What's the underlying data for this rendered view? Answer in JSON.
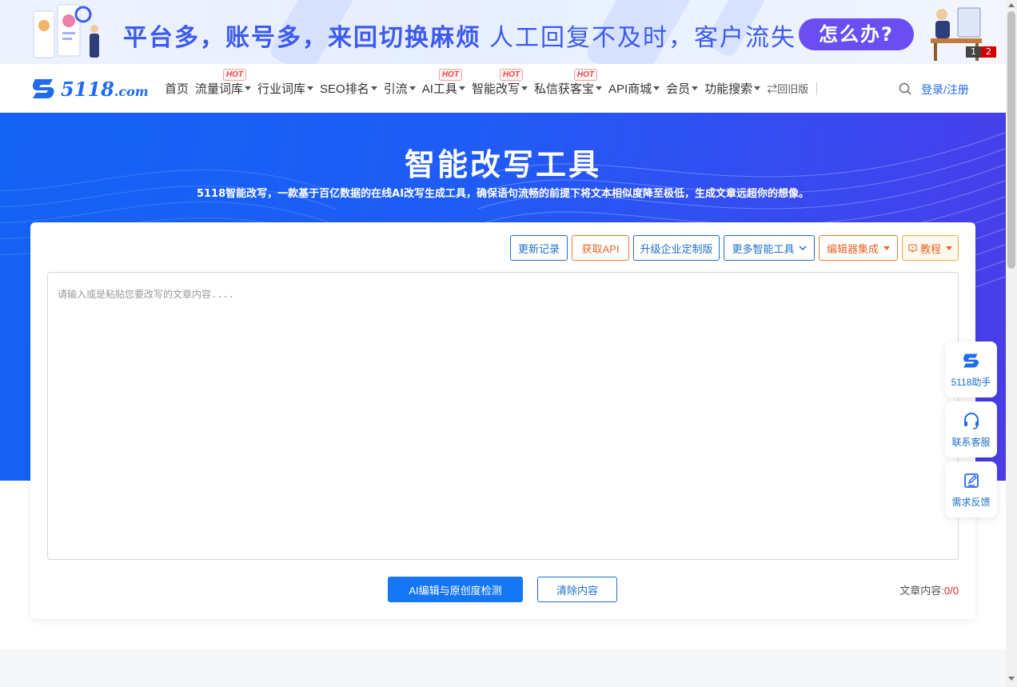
{
  "banner": {
    "headline_left": "平台多，账号多，来回切换麻烦",
    "headline_right": "人工回复不及时，客户流失",
    "cta": "怎么办?",
    "pages": [
      "1",
      "2"
    ]
  },
  "nav": {
    "logo_text": "5118",
    "logo_suffix": ".com",
    "items": [
      {
        "label": "首页",
        "caret": false,
        "hot": false
      },
      {
        "label": "流量词库",
        "caret": true,
        "hot": true
      },
      {
        "label": "行业词库",
        "caret": true,
        "hot": false
      },
      {
        "label": "SEO排名",
        "caret": true,
        "hot": false
      },
      {
        "label": "引流",
        "caret": true,
        "hot": false
      },
      {
        "label": "AI工具",
        "caret": true,
        "hot": true
      },
      {
        "label": "智能改写",
        "caret": true,
        "hot": true
      },
      {
        "label": "私信获客宝",
        "caret": true,
        "hot": true
      },
      {
        "label": "API商城",
        "caret": true,
        "hot": false
      },
      {
        "label": "会员",
        "caret": true,
        "hot": false
      },
      {
        "label": "功能搜索",
        "caret": true,
        "hot": false
      }
    ],
    "hot_label": "HOT",
    "back_label": "⇄回旧版",
    "login_label": "登录/注册"
  },
  "hero": {
    "title": "智能改写工具",
    "subtitle": "5118智能改写，一款基于百亿数据的在线AI改写生成工具，确保语句流畅的前提下将文本相似度降至极低，生成文章远超你的想像。"
  },
  "toolbar": {
    "changelog": "更新记录",
    "get_api": "获取API",
    "enterprise": "升级企业定制版",
    "more_tools": "更多智能工具",
    "editor_integration": "编辑器集成",
    "tutorial": "教程"
  },
  "editor": {
    "placeholder": "请输入或是粘贴您要改写的文章内容....",
    "value": ""
  },
  "actions": {
    "primary": "AI编辑与原创度检测",
    "clear": "清除内容",
    "count_label": "文章内容:",
    "count_value": "0/0"
  },
  "floating": {
    "assistant": "5118助手",
    "support": "联系客服",
    "feedback": "需求反馈"
  },
  "colors": {
    "brand": "#1f6cf0",
    "hero_start": "#1463f5",
    "hero_end": "#4b3ce8",
    "cta": "#6b4ef2",
    "orange": "#e8662a",
    "hot": "#ef4444"
  }
}
